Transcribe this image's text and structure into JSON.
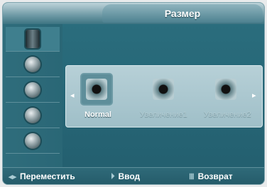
{
  "title": "Размер",
  "sidebar": {
    "items": [
      {
        "icon": "picture-icon"
      },
      {
        "icon": "sound-icon"
      },
      {
        "icon": "channel-icon"
      },
      {
        "icon": "setup-icon"
      },
      {
        "icon": "input-icon"
      }
    ]
  },
  "size_options": [
    {
      "label": "Normal",
      "selected": true
    },
    {
      "label": "Увеличение1",
      "selected": false
    },
    {
      "label": "Увеличение2",
      "selected": false
    }
  ],
  "bottom_hints": [
    {
      "icon": "navigate-icon",
      "label": "Переместить"
    },
    {
      "icon": "enter-icon",
      "label": "Ввод"
    },
    {
      "icon": "return-icon",
      "label": "Возврат"
    }
  ]
}
